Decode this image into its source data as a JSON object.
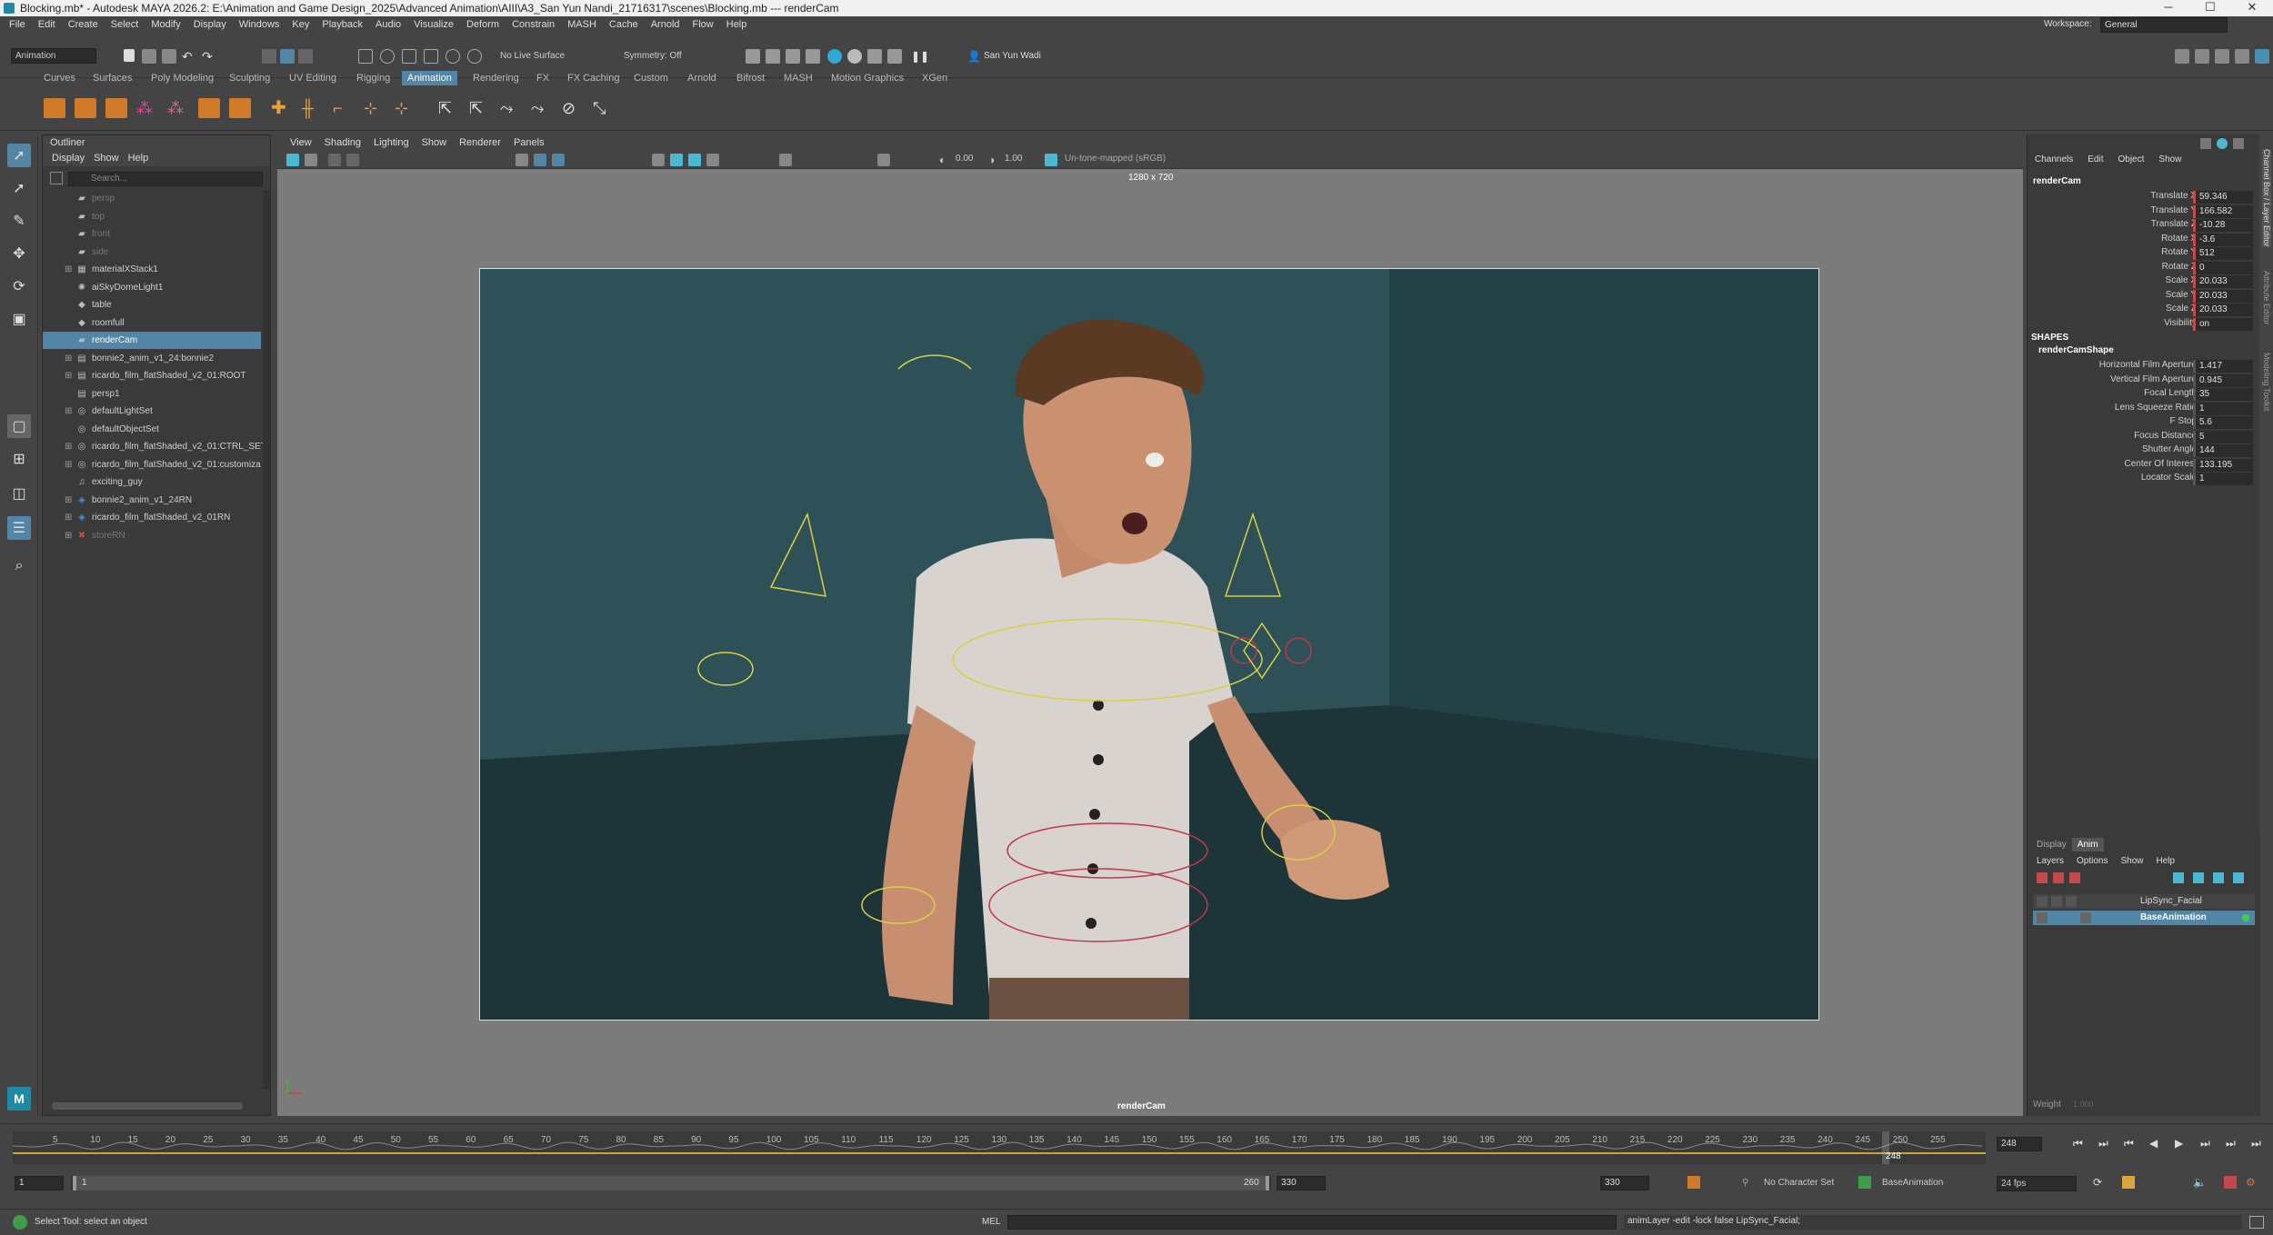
{
  "window": {
    "title": "Blocking.mb* - Autodesk MAYA 2026.2: E:\\Animation and Game Design_2025\\Advanced Animation\\AIII\\A3_San Yun Nandi_21716317\\scenes\\Blocking.mb   ---   renderCam",
    "minimize": "─",
    "maximize": "☐",
    "close": "✕"
  },
  "menubar": [
    "File",
    "Edit",
    "Create",
    "Select",
    "Modify",
    "Display",
    "Windows",
    "Key",
    "Playback",
    "Audio",
    "Visualize",
    "Deform",
    "Constrain",
    "MASH",
    "Cache",
    "Arnold",
    "Flow",
    "Help"
  ],
  "workspace": {
    "label": "Workspace:",
    "value": "General"
  },
  "statusline": {
    "menuset": "Animation",
    "live_surface": "No Live Surface",
    "symmetry": "Symmetry: Off",
    "user": "San Yun Wadi"
  },
  "shelf_tabs": [
    "Curves",
    "Surfaces",
    "Poly Modeling",
    "Sculpting",
    "UV Editing",
    "Rigging",
    "Animation",
    "Rendering",
    "FX",
    "FX Caching",
    "Custom",
    "Arnold",
    "Bifrost",
    "MASH",
    "Motion Graphics",
    "XGen"
  ],
  "active_shelf_tab": "Animation",
  "outliner": {
    "title": "Outliner",
    "menus": [
      "Display",
      "Show",
      "Help"
    ],
    "search_placeholder": "Search...",
    "items": [
      {
        "label": "persp",
        "icon": "camera-icon",
        "dim": true,
        "expand": ""
      },
      {
        "label": "top",
        "icon": "camera-icon",
        "dim": true,
        "expand": ""
      },
      {
        "label": "front",
        "icon": "camera-icon",
        "dim": true,
        "expand": ""
      },
      {
        "label": "side",
        "icon": "camera-icon",
        "dim": true,
        "expand": ""
      },
      {
        "label": "materialXStack1",
        "icon": "shape-icon",
        "dim": false,
        "expand": "⊞"
      },
      {
        "label": "aiSkyDomeLight1",
        "icon": "light-icon",
        "dim": false,
        "expand": ""
      },
      {
        "label": "table",
        "icon": "mesh-icon",
        "dim": false,
        "expand": ""
      },
      {
        "label": "roomfull",
        "icon": "mesh-icon",
        "dim": false,
        "expand": ""
      },
      {
        "label": "renderCam",
        "icon": "camera-icon",
        "dim": false,
        "expand": "",
        "selected": true
      },
      {
        "label": "bonnie2_anim_v1_24:bonnie2",
        "icon": "group-icon",
        "dim": false,
        "expand": "⊞"
      },
      {
        "label": "ricardo_film_flatShaded_v2_01:ROOT",
        "icon": "group-icon",
        "dim": false,
        "expand": "⊞"
      },
      {
        "label": "persp1",
        "icon": "group-icon",
        "dim": false,
        "expand": ""
      },
      {
        "label": "defaultLightSet",
        "icon": "set-icon",
        "dim": false,
        "expand": "⊞"
      },
      {
        "label": "defaultObjectSet",
        "icon": "set-icon",
        "dim": false,
        "expand": ""
      },
      {
        "label": "ricardo_film_flatShaded_v2_01:CTRL_SET",
        "icon": "set-icon",
        "dim": false,
        "expand": "⊞"
      },
      {
        "label": "ricardo_film_flatShaded_v2_01:customiza",
        "icon": "set-icon",
        "dim": false,
        "expand": "⊞"
      },
      {
        "label": "exciting_guy",
        "icon": "audio-icon",
        "dim": false,
        "expand": ""
      },
      {
        "label": "bonnie2_anim_v1_24RN",
        "icon": "reference-icon",
        "dim": false,
        "expand": "⊞"
      },
      {
        "label": "ricardo_film_flatShaded_v2_01RN",
        "icon": "reference-icon",
        "dim": false,
        "expand": "⊞"
      },
      {
        "label": "storeRN",
        "icon": "reference-missing-icon",
        "dim": true,
        "expand": "⊞"
      }
    ]
  },
  "viewport": {
    "menus": [
      "View",
      "Shading",
      "Lighting",
      "Show",
      "Renderer",
      "Panels"
    ],
    "exposure": "0.00",
    "gamma": "1.00",
    "colorspace": "Un-tone-mapped (sRGB)",
    "resolution": "1280 x 720",
    "camera_label": "renderCam"
  },
  "channelbox": {
    "tabs": [
      "Channels",
      "Edit",
      "Object",
      "Show"
    ],
    "object": "renderCam",
    "attrs": [
      {
        "name": "Translate X",
        "value": "59.346",
        "keyed": true
      },
      {
        "name": "Translate Y",
        "value": "166.582",
        "keyed": true
      },
      {
        "name": "Translate Z",
        "value": "-10.28",
        "keyed": true
      },
      {
        "name": "Rotate X",
        "value": "-3.6",
        "keyed": true
      },
      {
        "name": "Rotate Y",
        "value": "512",
        "keyed": true
      },
      {
        "name": "Rotate Z",
        "value": "0",
        "keyed": true
      },
      {
        "name": "Scale X",
        "value": "20.033",
        "keyed": true
      },
      {
        "name": "Scale Y",
        "value": "20.033",
        "keyed": true
      },
      {
        "name": "Scale Z",
        "value": "20.033",
        "keyed": true
      },
      {
        "name": "Visibility",
        "value": "on",
        "keyed": true
      }
    ],
    "shapes_header": "SHAPES",
    "shape_name": "renderCamShape",
    "shape_attrs": [
      {
        "name": "Horizontal Film Aperture",
        "value": "1.417"
      },
      {
        "name": "Vertical Film Aperture",
        "value": "0.945"
      },
      {
        "name": "Focal Length",
        "value": "35"
      },
      {
        "name": "Lens Squeeze Ratio",
        "value": "1"
      },
      {
        "name": "F Stop",
        "value": "5.6"
      },
      {
        "name": "Focus Distance",
        "value": "5"
      },
      {
        "name": "Shutter Angle",
        "value": "144"
      },
      {
        "name": "Center Of Interest",
        "value": "133.195"
      },
      {
        "name": "Locator Scale",
        "value": "1"
      }
    ]
  },
  "layer_editor": {
    "tabs": [
      "Display",
      "Anim"
    ],
    "active_tab": "Anim",
    "menus": [
      "Layers",
      "Options",
      "Show",
      "Help"
    ],
    "layers": [
      {
        "name": "LipSync_Facial",
        "selected": false
      },
      {
        "name": "BaseAnimation",
        "selected": true
      }
    ],
    "weight_label": "Weight",
    "weight_value": "1.000"
  },
  "side_tabs": [
    "Channel Box / Layer Editor",
    "Attribute Editor",
    "Modeling Toolkit"
  ],
  "timeslider": {
    "ticks": [
      "5",
      "10",
      "15",
      "20",
      "25",
      "30",
      "35",
      "40",
      "45",
      "50",
      "55",
      "60",
      "65",
      "70",
      "75",
      "80",
      "85",
      "90",
      "95",
      "100",
      "105",
      "110",
      "115",
      "120",
      "125",
      "130",
      "135",
      "140",
      "145",
      "150",
      "155",
      "160",
      "165",
      "170",
      "175",
      "180",
      "185",
      "190",
      "195",
      "200",
      "205",
      "210",
      "215",
      "220",
      "225",
      "230",
      "235",
      "240",
      "245",
      "250",
      "255"
    ],
    "current_frame": "248",
    "current_field": "248"
  },
  "rangeslider": {
    "start": "1",
    "range_start": "1",
    "range_end": "260",
    "end": "330",
    "character_set": "No Character Set",
    "anim_layer": "BaseAnimation",
    "fps": "24 fps"
  },
  "commandline": {
    "help_text": "Select Tool: select an object",
    "lang": "MEL",
    "result": "animLayer -edit -lock false LipSync_Facial;"
  },
  "colors": {
    "selection": "#5285a6",
    "keyed": "#c34a4a",
    "background": "#444444",
    "accent": "#4ab8d0"
  }
}
